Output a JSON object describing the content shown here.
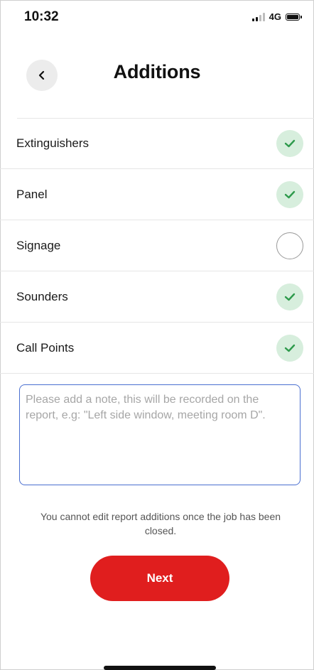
{
  "status_bar": {
    "time": "10:32",
    "network": "4G",
    "icons": [
      "signal-icon",
      "battery-icon"
    ]
  },
  "header": {
    "back_icon": "chevron-left-icon",
    "title": "Additions"
  },
  "additions": {
    "items": [
      {
        "label": "Extinguishers",
        "checked": true
      },
      {
        "label": "Panel",
        "checked": true
      },
      {
        "label": "Signage",
        "checked": false
      },
      {
        "label": "Sounders",
        "checked": true
      },
      {
        "label": "Call Points",
        "checked": true
      }
    ]
  },
  "note": {
    "value": "",
    "placeholder": "Please add a note, this will be recorded on the report, e.g: \"Left side window, meeting room D\"."
  },
  "info": {
    "text": "You cannot edit report additions once the job has been closed."
  },
  "actions": {
    "next_label": "Next"
  },
  "colors": {
    "accent": "#e01e1e",
    "check_bg": "#d7eedd",
    "check_mark": "#2e9a4c",
    "focus_border": "#4a6fd0"
  }
}
